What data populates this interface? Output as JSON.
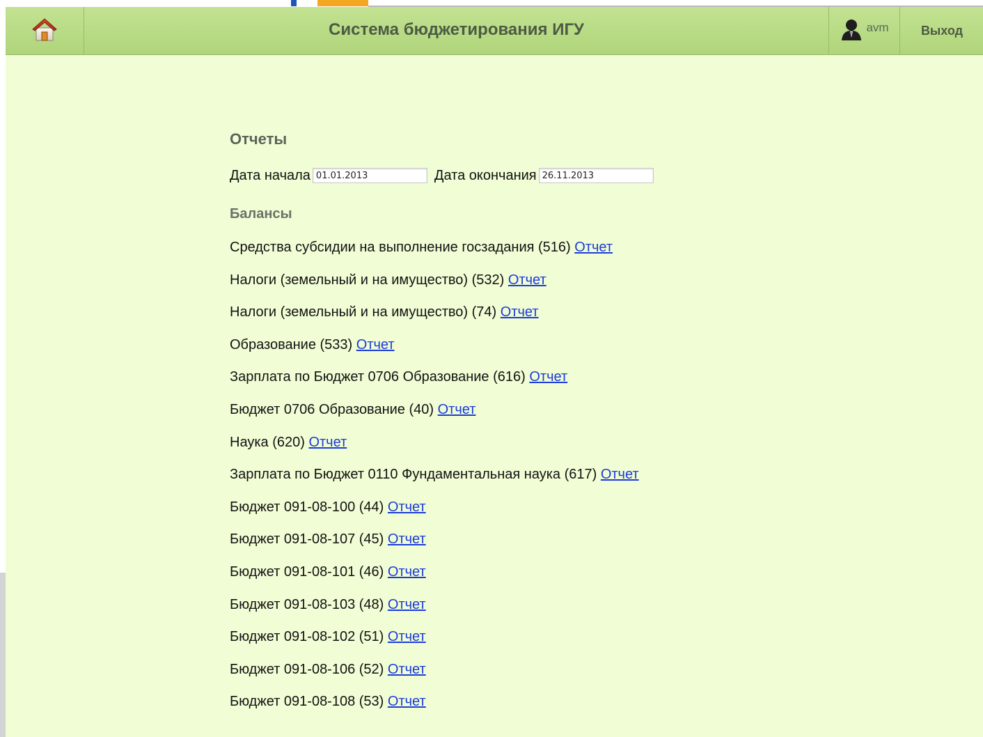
{
  "header": {
    "title": "Система бюджетирования ИГУ",
    "user": "avm",
    "logout_label": "Выход"
  },
  "reports": {
    "title": "Отчеты",
    "start_label": "Дата начала",
    "start_value": "01.01.2013",
    "end_label": "Дата окончания",
    "end_value": "26.11.2013",
    "balances_title": "Балансы",
    "link_label": "Отчет",
    "items": [
      {
        "text": "Средства субсидии на выполнение госзадания (516)"
      },
      {
        "text": "Налоги (земельный и на имущество) (532)"
      },
      {
        "text": "Налоги (земельный и на имущество) (74)"
      },
      {
        "text": "Образование (533)"
      },
      {
        "text": "Зарплата по Бюджет 0706 Образование (616)"
      },
      {
        "text": "Бюджет 0706 Образование (40)"
      },
      {
        "text": "Наука (620)"
      },
      {
        "text": "Зарплата по Бюджет 0110 Фундаментальная наука (617)"
      },
      {
        "text": "Бюджет 091-08-100 (44)"
      },
      {
        "text": "Бюджет 091-08-107 (45)"
      },
      {
        "text": "Бюджет 091-08-101 (46)"
      },
      {
        "text": "Бюджет 091-08-103 (48)"
      },
      {
        "text": "Бюджет 091-08-102 (51)"
      },
      {
        "text": "Бюджет 091-08-106 (52)"
      },
      {
        "text": "Бюджет 091-08-108 (53)"
      }
    ]
  },
  "colors": {
    "header_bg": "#b8da86",
    "page_bg": "#f1fdd5",
    "link": "#1a3cd8"
  },
  "icons": {
    "home": "home-icon",
    "user": "user-avatar-icon"
  }
}
